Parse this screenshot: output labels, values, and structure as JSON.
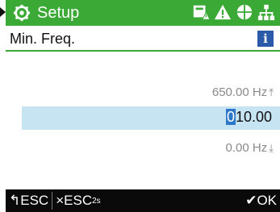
{
  "header": {
    "title": "Setup",
    "colors": {
      "accent": "#3aa935"
    },
    "icons": [
      "gear-icon",
      "memory-warning-icon",
      "warning-icon",
      "globe-icon",
      "network-icon"
    ]
  },
  "parameter": {
    "name": "Min. Freq.",
    "info_label": "i"
  },
  "editor": {
    "max_value": "650.00 Hz",
    "cursor_digit": "0",
    "value_rest": "10.00",
    "min_value": "0.00 Hz"
  },
  "footer": {
    "back_label": "ESC",
    "cancel_label": "ESC",
    "cancel_sub": "2s",
    "ok_label": "OK"
  }
}
